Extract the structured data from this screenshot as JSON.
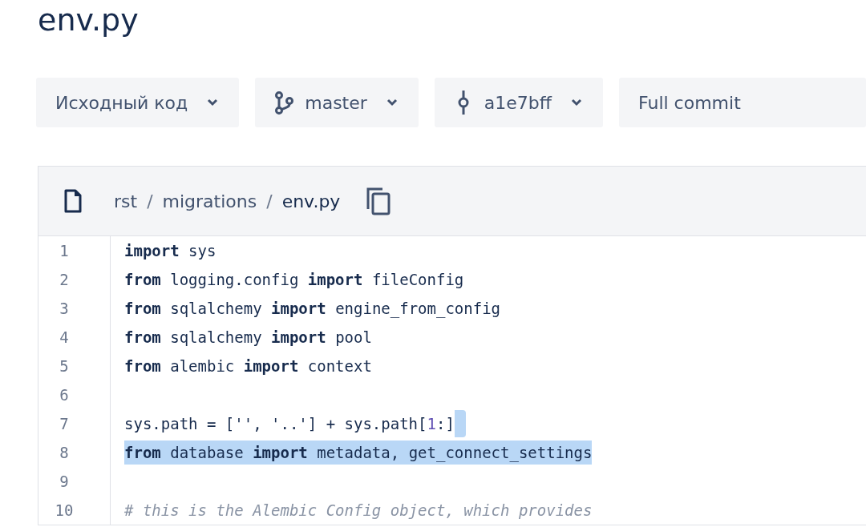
{
  "title": "env.py",
  "toolbar": [
    {
      "kind": "dropdown",
      "label": "Исходный код"
    },
    {
      "kind": "branch-dropdown",
      "label": "master"
    },
    {
      "kind": "commit-dropdown",
      "label": "a1e7bff"
    },
    {
      "kind": "plain",
      "label": "Full commit"
    }
  ],
  "file": {
    "breadcrumb": [
      "rst",
      "migrations",
      "env.py"
    ],
    "separator": "/",
    "lines": [
      {
        "number": "1",
        "selected": false,
        "newline_selected": false,
        "tokens": [
          {
            "kind": "kw",
            "text": "import"
          },
          {
            "kind": "plain",
            "text": " sys"
          }
        ]
      },
      {
        "number": "2",
        "selected": false,
        "newline_selected": false,
        "tokens": [
          {
            "kind": "kw",
            "text": "from"
          },
          {
            "kind": "plain",
            "text": " logging.config "
          },
          {
            "kind": "kw",
            "text": "import"
          },
          {
            "kind": "plain",
            "text": " fileConfig"
          }
        ]
      },
      {
        "number": "3",
        "selected": false,
        "newline_selected": false,
        "tokens": [
          {
            "kind": "kw",
            "text": "from"
          },
          {
            "kind": "plain",
            "text": " sqlalchemy "
          },
          {
            "kind": "kw",
            "text": "import"
          },
          {
            "kind": "plain",
            "text": " engine_from_config"
          }
        ]
      },
      {
        "number": "4",
        "selected": false,
        "newline_selected": false,
        "tokens": [
          {
            "kind": "kw",
            "text": "from"
          },
          {
            "kind": "plain",
            "text": " sqlalchemy "
          },
          {
            "kind": "kw",
            "text": "import"
          },
          {
            "kind": "plain",
            "text": " pool"
          }
        ]
      },
      {
        "number": "5",
        "selected": false,
        "newline_selected": false,
        "tokens": [
          {
            "kind": "kw",
            "text": "from"
          },
          {
            "kind": "plain",
            "text": " alembic "
          },
          {
            "kind": "kw",
            "text": "import"
          },
          {
            "kind": "plain",
            "text": " context"
          }
        ]
      },
      {
        "number": "6",
        "selected": false,
        "newline_selected": false
      },
      {
        "number": "7",
        "selected": false,
        "newline_selected": true,
        "tokens": [
          {
            "kind": "plain",
            "text": "sys.path = ['', '..'] + sys.path["
          },
          {
            "kind": "num",
            "text": "1"
          },
          {
            "kind": "plain",
            "text": ":]"
          }
        ]
      },
      {
        "number": "8",
        "selected": true,
        "newline_selected": false,
        "tokens": [
          {
            "kind": "kw",
            "text": "from"
          },
          {
            "kind": "plain",
            "text": " database "
          },
          {
            "kind": "kw",
            "text": "import"
          },
          {
            "kind": "plain",
            "text": " metadata, get_connect_settings"
          }
        ]
      },
      {
        "number": "9",
        "selected": false,
        "newline_selected": false
      },
      {
        "number": "10",
        "selected": false,
        "newline_selected": false,
        "tokens": [
          {
            "kind": "comment",
            "text": "# this is the Alembic Config object, which provides"
          }
        ]
      }
    ]
  }
}
